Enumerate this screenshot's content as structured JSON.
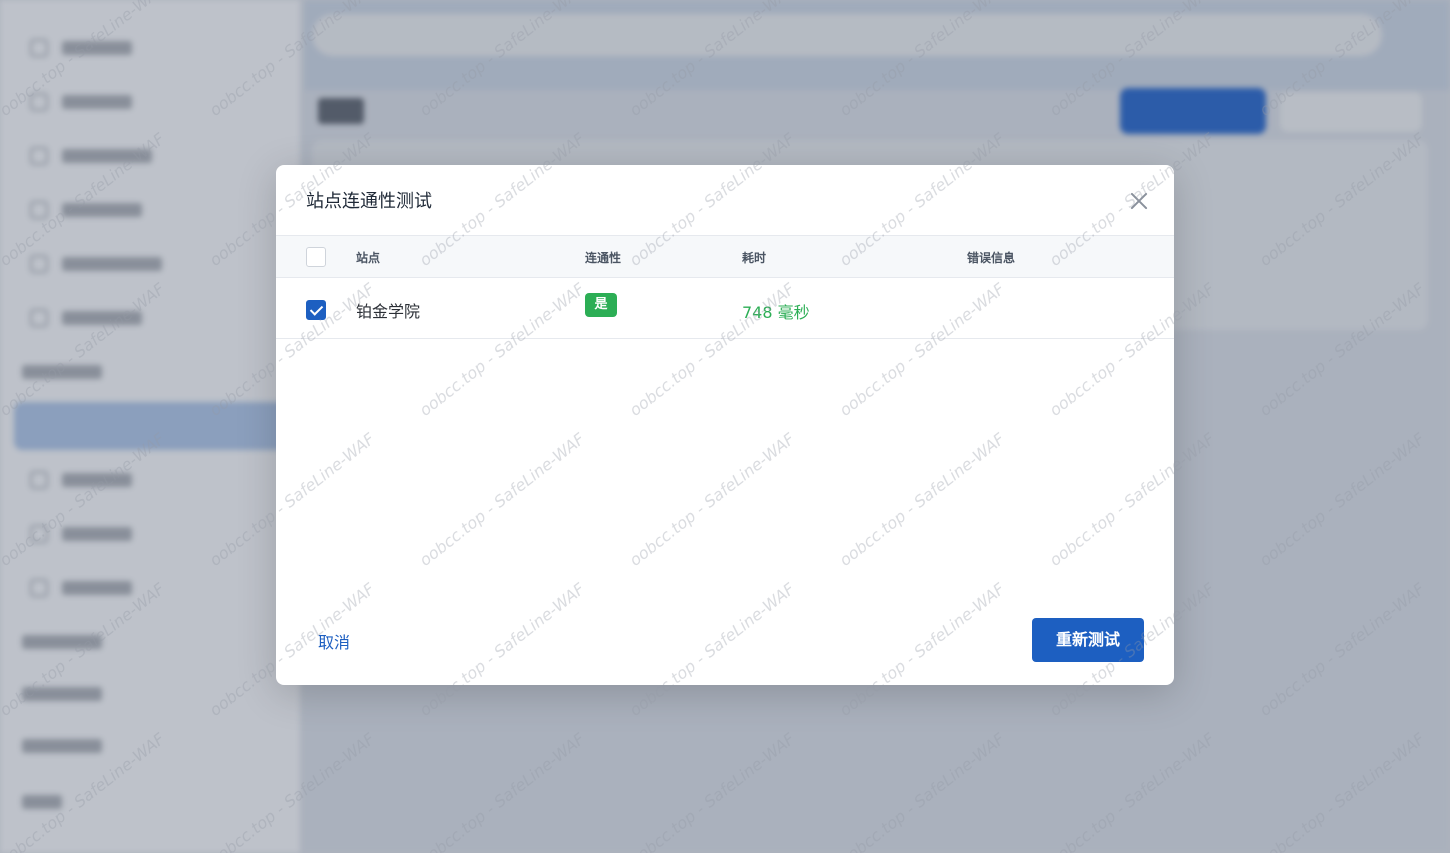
{
  "dialog": {
    "title": "站点连通性测试",
    "table": {
      "headers": {
        "site": "站点",
        "connectivity": "连通性",
        "duration": "耗时",
        "error": "错误信息"
      },
      "rows": [
        {
          "checked": true,
          "site": "铂金学院",
          "connectivity": "是",
          "duration": "748 毫秒",
          "error": ""
        }
      ]
    },
    "cancel_label": "取消",
    "retest_label": "重新测试"
  },
  "watermark": {
    "text": "oobcc.top - SafeLine-WAF"
  },
  "colors": {
    "primary": "#1d5fc1",
    "success": "#2cae55",
    "overlay": "#b9bfc9"
  }
}
